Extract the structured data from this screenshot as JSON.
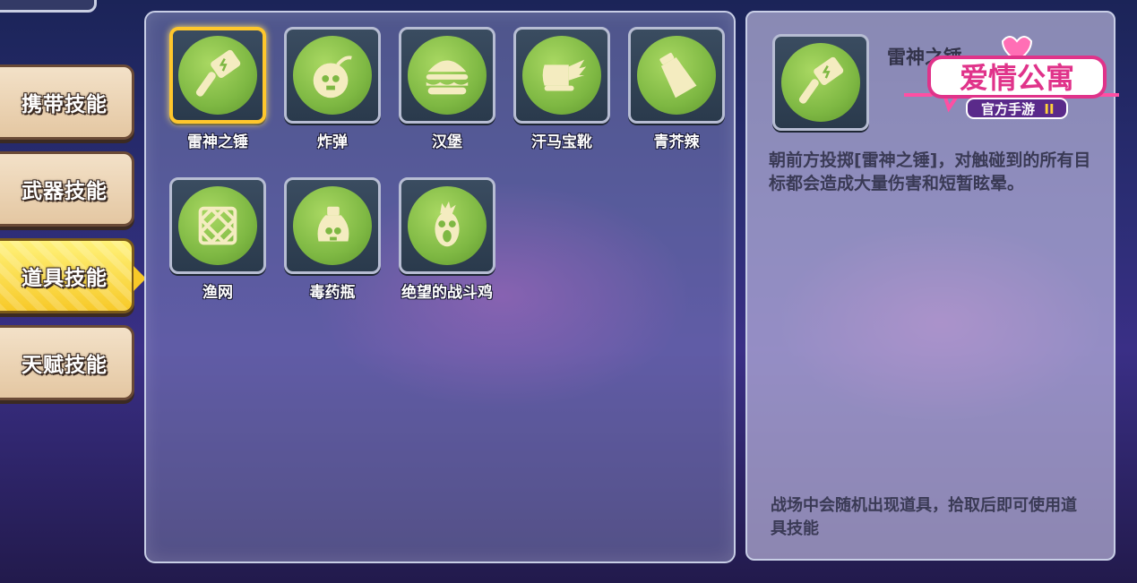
{
  "tabs": [
    {
      "label": "携带技能",
      "active": false
    },
    {
      "label": "武器技能",
      "active": false
    },
    {
      "label": "道具技能",
      "active": true
    },
    {
      "label": "天赋技能",
      "active": false
    }
  ],
  "skills": [
    {
      "name": "雷神之锤",
      "icon": "hammer-icon",
      "selected": true
    },
    {
      "name": "炸弹",
      "icon": "bomb-icon"
    },
    {
      "name": "汉堡",
      "icon": "burger-icon"
    },
    {
      "name": "汗马宝靴",
      "icon": "winged-boot-icon"
    },
    {
      "name": "青芥辣",
      "icon": "wasabi-tube-icon"
    },
    {
      "name": "渔网",
      "icon": "fishing-net-icon"
    },
    {
      "name": "毒药瓶",
      "icon": "poison-bottle-icon"
    },
    {
      "name": "绝望的战斗鸡",
      "icon": "battle-chicken-icon"
    }
  ],
  "detail": {
    "title": "雷神之锤",
    "icon": "hammer-icon",
    "description": "朝前方投掷[雷神之锤]，对触碰到的所有目标都会造成大量伤害和短暂眩晕。",
    "tip": "战场中会随机出现道具，拾取后即可使用道具技能"
  },
  "logo": {
    "line1": "爱情公寓",
    "line2": "官方手游",
    "badge": "II"
  },
  "colors": {
    "icon_green": "#7eb843",
    "icon_glyph": "#f4ecc0",
    "selected_border": "#ffc72c",
    "active_tab": "#f7c928"
  }
}
